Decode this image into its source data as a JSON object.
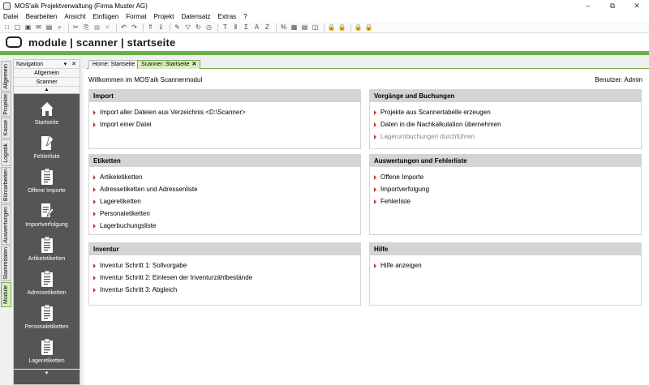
{
  "window": {
    "title": "MOS'aik Projektverwaltung (Firma Muster AG)",
    "controls": [
      "–",
      "⧉",
      "✕"
    ]
  },
  "menu": [
    "Datei",
    "Bearbeiten",
    "Ansicht",
    "Einfügen",
    "Format",
    "Projekt",
    "Datensatz",
    "Extras",
    "?"
  ],
  "toolbar": {
    "icons": [
      "new-icon",
      "open-icon",
      "save-icon",
      "mail-icon",
      "print-preview-icon",
      "search-icon",
      "cut-icon",
      "copy-icon",
      "paste-icon",
      "delete-icon",
      "undo-icon",
      "redo-icon",
      "sort-up-icon",
      "sort-down-icon",
      "edit-icon",
      "filter-icon",
      "refresh-icon",
      "clock-icon",
      "text-icon",
      "column-icon",
      "sum-icon",
      "letter-a-icon",
      "letter-z-icon",
      "percent-icon",
      "grid-icon",
      "calc-icon",
      "window-icon",
      "lock-yellow-icon",
      "lock-red-icon",
      "lock-blue-icon",
      "lock-gold-icon"
    ],
    "glyphs": [
      "□",
      "▢",
      "▣",
      "✉",
      "▤",
      "⌕",
      "✂",
      "⎘",
      "▦",
      "✕",
      "↶",
      "↷",
      "⇑",
      "⇓",
      "✎",
      "▽",
      "↻",
      "◷",
      "T",
      "⫴",
      "Σ",
      "A",
      "Z",
      "%",
      "▦",
      "▤",
      "◫",
      "🔒",
      "🔒",
      "🔒",
      "🔒"
    ]
  },
  "module_header": {
    "title": "module | scanner | startseite"
  },
  "side_tabs": [
    "Allgemein",
    "Projekte",
    "Kasse",
    "Logistik",
    "Büroarbeiten",
    "Auswertungen",
    "Stammdaten",
    "Module"
  ],
  "navigation": {
    "title": "Navigation",
    "header_buttons": "▾ ✕",
    "crumb_top": "Allgemein",
    "crumb_current": "Scanner",
    "up_arrow": "▲",
    "down_arrow": "▼",
    "items": [
      {
        "label": "Startseite",
        "icon": "home-icon"
      },
      {
        "label": "Fehlerliste",
        "icon": "document-edit-icon"
      },
      {
        "label": "Offene Importe",
        "icon": "clipboard-icon"
      },
      {
        "label": "Importverfolgung",
        "icon": "document-pen-icon"
      },
      {
        "label": "Artikeletiketten",
        "icon": "clipboard-icon"
      },
      {
        "label": "Adressetiketten",
        "icon": "clipboard-icon"
      },
      {
        "label": "Personaletiketten",
        "icon": "clipboard-icon"
      },
      {
        "label": "Lageretiketten",
        "icon": "clipboard-icon"
      }
    ]
  },
  "tabs": [
    {
      "label": "Home: Startseite",
      "active": false
    },
    {
      "label": "Scanner: Startseite",
      "active": true,
      "close": "✕"
    }
  ],
  "content": {
    "welcome": "Willkommen im MOS'aik Scannermodul",
    "user": "Benutzer: Admin",
    "panels": [
      {
        "title": "Import",
        "items": [
          {
            "label": "Import aller Dateien aus Verzeichnis <D:\\Scanner>",
            "disabled": false
          },
          {
            "label": "Import einer Datei",
            "disabled": false
          }
        ]
      },
      {
        "title": "Vorgänge und Buchungen",
        "items": [
          {
            "label": "Projekte aus Scannertabelle erzeugen",
            "disabled": false
          },
          {
            "label": "Daten in die Nachkalkulation übernehmen",
            "disabled": false
          },
          {
            "label": "Lagerumbuchungen durchführen",
            "disabled": true
          }
        ]
      },
      {
        "title": "Etiketten",
        "items": [
          {
            "label": "Artikeletiketten",
            "disabled": false
          },
          {
            "label": "Adressetiketten und Adressenliste",
            "disabled": false
          },
          {
            "label": "Lageretiketten",
            "disabled": false
          },
          {
            "label": "Personaletiketten",
            "disabled": false
          },
          {
            "label": "Lagerbuchungsliste",
            "disabled": false
          }
        ]
      },
      {
        "title": "Auswertungen und Fehlerliste",
        "items": [
          {
            "label": "Offene Importe",
            "disabled": false
          },
          {
            "label": "Importverfolgung",
            "disabled": false
          },
          {
            "label": "Fehlerliste",
            "disabled": false
          }
        ]
      },
      {
        "title": "Inventur",
        "items": [
          {
            "label": "Inventur Schritt 1: Sollvorgabe",
            "disabled": false
          },
          {
            "label": "Inventur Schritt 2: Einlesen der Inventurzählbestände",
            "disabled": false
          },
          {
            "label": "Inventur Schritt 3: Abgleich",
            "disabled": false
          }
        ]
      },
      {
        "title": "Hilfe",
        "items": [
          {
            "label": "Hilfe anzeigen",
            "disabled": false
          }
        ]
      }
    ]
  },
  "colors": {
    "accent_green": "#6ab04c",
    "tab_active": "#d8eec0",
    "nav_bg": "#555555",
    "panel_header": "#d4d4d4",
    "link_arrow": "#c0392b"
  }
}
